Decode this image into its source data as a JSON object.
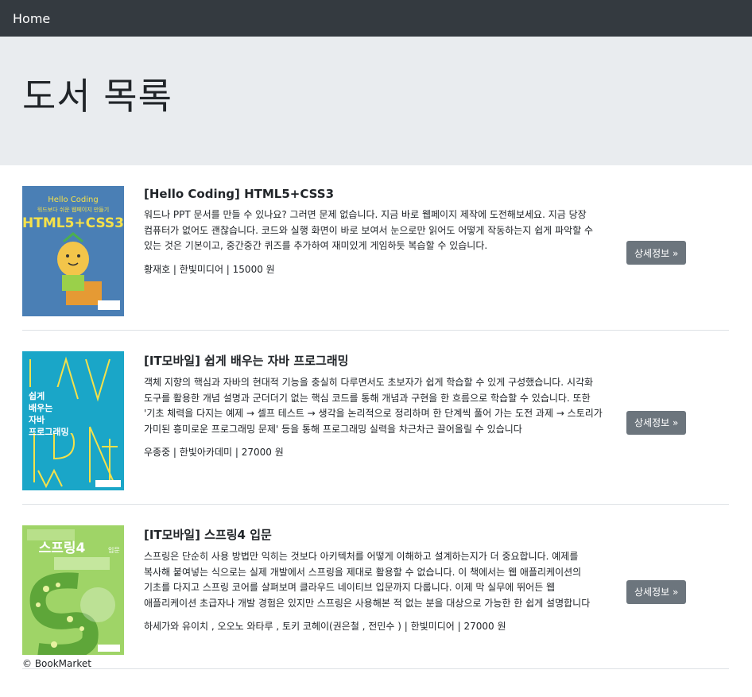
{
  "nav": {
    "brand": "Home"
  },
  "header": {
    "title": "도서 목록"
  },
  "books": [
    {
      "title": "[Hello Coding] HTML5+CSS3",
      "description": "워드나 PPT 문서를 만들 수 있나요? 그러면 문제 없습니다. 지금 바로 웹페이지 제작에 도전해보세요. 지금 당장 컴퓨터가 없어도 괜찮습니다. 코드와 실행 화면이 바로 보여서 눈으로만 읽어도 어떻게 작동하는지 쉽게 파악할 수 있는 것은 기본이고, 중간중간 퀴즈를 추가하여 재미있게 게임하듯 복습할 수 있습니다.",
      "meta": "황재호 | 한빛미디어 | 15000 원",
      "button": "상세정보 »",
      "cover": {
        "top_text": "Hello Coding",
        "sub_text": "워드보다 쉬운 웹페이지 만들기",
        "main_text": "HTML5+CSS3",
        "bg": "#4a7fb5"
      }
    },
    {
      "title": "[IT모바일] 쉽게 배우는 자바 프로그래밍",
      "description": "객체 지향의 핵심과 자바의 현대적 기능을 충실히 다루면서도 초보자가 쉽게 학습할 수 있게 구성했습니다. 시각화 도구를 활용한 개념 설명과 군더더기 없는 핵심 코드를 통해 개념과 구현을 한 흐름으로 학습할 수 있습니다. 또한 '기초 체력을 다지는 예제 → 셀프 테스트 → 생각을 논리적으로 정리하며 한 단계씩 풀어 가는 도전 과제 → 스토리가 가미된 흥미로운 프로그래밍 문제' 등을 통해 프로그래밍 실력을 차근차근 끌어올릴 수 있습니다",
      "meta": "우종중 | 한빛아카데미 | 27000 원",
      "button": "상세정보 »",
      "cover": {
        "main_text": "쉽게 배우는 자바 프로그래밍",
        "bg": "#1aa6c8"
      }
    },
    {
      "title": "[IT모바일] 스프링4 입문",
      "description": "스프링은 단순히 사용 방법만 익히는 것보다 아키텍처를 어떻게 이해하고 설계하는지가 더 중요합니다. 예제를 복사해 붙여넣는 식으로는 실제 개발에서 스프링을 제대로 활용할 수 없습니다. 이 책에서는 웹 애플리케이션의 기초를 다지고 스프링 코어를 살펴보며 클라우드 네이티브 입문까지 다룹니다. 이제 막 실무에 뛰어든 웹 애플리케이션 초급자나 개발 경험은 있지만 스프링은 사용해본 적 없는 분을 대상으로 가능한 한 쉽게 설명합니다",
      "meta": "하세가와 유이치 , 오오노 와타루 , 토키 코헤이(권은철 , 전민수 ) | 한빛미디어 | 27000 원",
      "button": "상세정보 »",
      "cover": {
        "main_text": "스프링4",
        "sub_text": "입문",
        "bg": "#9fd467"
      }
    }
  ],
  "footer": {
    "text": "© BookMarket"
  }
}
